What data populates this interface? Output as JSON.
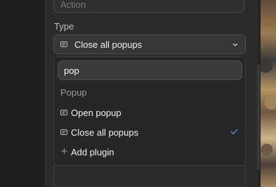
{
  "action_field": {
    "label": "Action"
  },
  "type_field": {
    "label": "Type",
    "selected": "Close all popups",
    "selected_icon": "popup-icon"
  },
  "dropdown": {
    "search_value": "pop",
    "group_label": "Popup",
    "options": [
      {
        "label": "Open popup",
        "icon": "popup-icon",
        "selected": false
      },
      {
        "label": "Close all popups",
        "icon": "popup-icon",
        "selected": true
      }
    ],
    "add_plugin_label": "Add plugin",
    "add_plugin_icon": "plus-icon"
  },
  "colors": {
    "accent_check": "#4f8cff",
    "panel_bg": "#2b2b2b",
    "dropdown_bg": "#262626"
  }
}
